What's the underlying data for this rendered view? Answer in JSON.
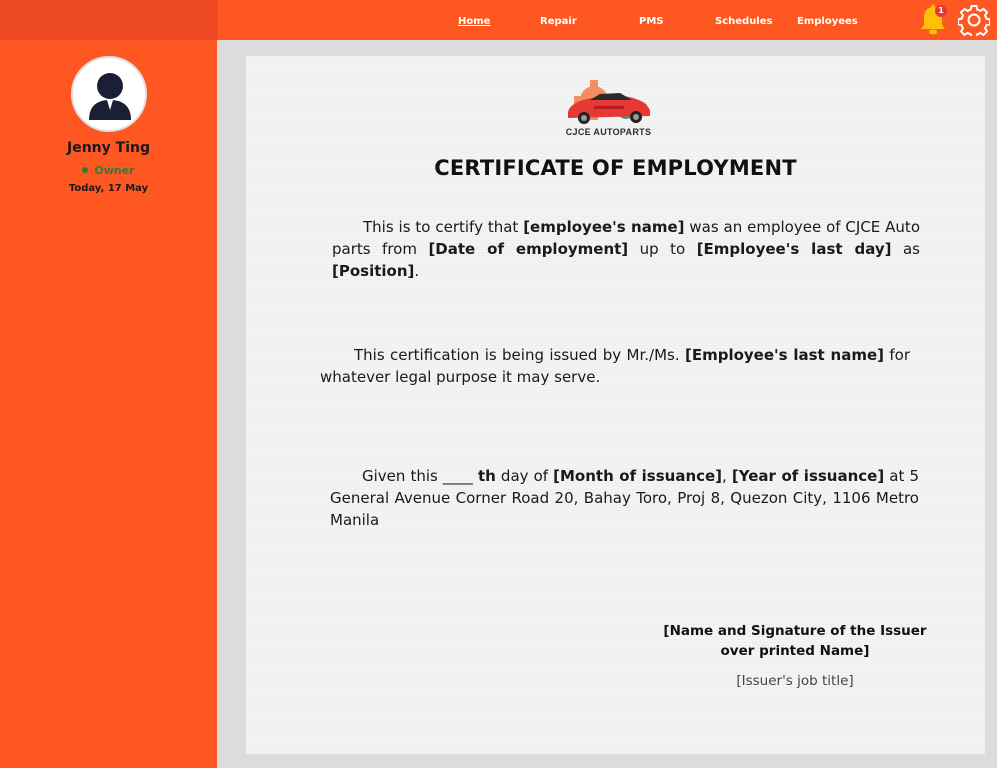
{
  "nav": {
    "items": [
      {
        "label": "Home",
        "active": true
      },
      {
        "label": "Repair",
        "active": false
      },
      {
        "label": "PMS",
        "active": false
      },
      {
        "label": "Schedules",
        "active": false
      },
      {
        "label": "Employees",
        "active": false
      }
    ],
    "notification_count": "1"
  },
  "sidebar": {
    "user_name": "Jenny Ting",
    "role": "Owner",
    "date": "Today, 17 May"
  },
  "document": {
    "logo_text": "CJCE AUTOPARTS",
    "title": "CERTIFICATE OF EMPLOYMENT",
    "p1": {
      "t1": "This is to certify that ",
      "b1": "[employee's name]",
      "t2": " was an employee of CJCE Auto parts from ",
      "b2": "[Date of employment]",
      "t3": " up to ",
      "b3": "[Employee's last day]",
      "t4": " as ",
      "b4": "[Position]",
      "t5": "."
    },
    "p2": {
      "t1": "This certification is being issued by Mr./Ms. ",
      "b1": "[Employee's last name]",
      "t2": " for whatever legal purpose it may serve."
    },
    "p3": {
      "t1": "Given this ____ ",
      "b1": "th",
      "t2": "  day of  ",
      "b2": "[Month of issuance]",
      "t3": ", ",
      "b3": "[Year of issuance]",
      "t4": " at 5 General Avenue Corner Road 20, Bahay Toro, Proj 8, Quezon City, 1106 Metro Manila"
    },
    "signature_line1": "[Name and Signature of the Issuer",
    "signature_line2": "over printed Name]",
    "job_title": "[Issuer's job title]"
  },
  "colors": {
    "primary": "#ff5722",
    "topbar_left": "#ee4a23",
    "role_green": "#2e7d32",
    "bell": "#ffc107",
    "badge": "#e53935"
  },
  "icons": [
    "bell-icon",
    "gear-icon",
    "user-avatar-icon"
  ]
}
